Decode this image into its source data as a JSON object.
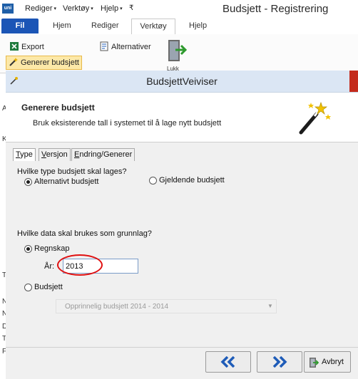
{
  "app": {
    "logo": "uni",
    "title": "Budsjett - Registrering",
    "quick_menus": [
      "Rediger",
      "Verktøy",
      "Hjelp"
    ],
    "qat_dropdown_glyph": "₹"
  },
  "ribbon": {
    "fil_label": "Fil",
    "tabs": [
      "Hjem",
      "Rediger",
      "Verktøy",
      "Hjelp"
    ],
    "buttons": {
      "export": "Export",
      "alternativer": "Alternativer",
      "generer": "Generer budsjett",
      "large_partial": "Lukk"
    }
  },
  "bg_left_letters": [
    "A",
    "K",
    "T",
    "N",
    "N",
    "D",
    "T",
    "F"
  ],
  "dialog": {
    "title": "BudsjettVeiviser",
    "header_title": "Generere budsjett",
    "header_subtitle": "Bruk eksisterende tall i systemet til å lage nytt budsjett",
    "tabs": [
      {
        "mnemonic": "T",
        "rest": "ype"
      },
      {
        "mnemonic": "V",
        "rest": "ersjon"
      },
      {
        "mnemonic": "E",
        "rest": "ndring/Generer"
      }
    ],
    "question_type": "Hvilke type budsjett skal lages?",
    "radio_alternativt": "Alternativt budsjett",
    "radio_gjeldende": "Gjeldende budsjett",
    "question_data": "Hvilke data skal brukes som grunnlag?",
    "radio_regnskap": "Regnskap",
    "aar_label": "År:",
    "aar_value": "2013",
    "radio_budsjett": "Budsjett",
    "budsjett_select": "Opprinnelig budsjett 2014 - 2014",
    "btn_avbryt": "Avbryt"
  },
  "colors": {
    "fil_tab": "#1b55b6",
    "highlight": "#fce8a8",
    "annotation_circle": "#e01010",
    "nav_arrows": "#1f5cb8"
  }
}
